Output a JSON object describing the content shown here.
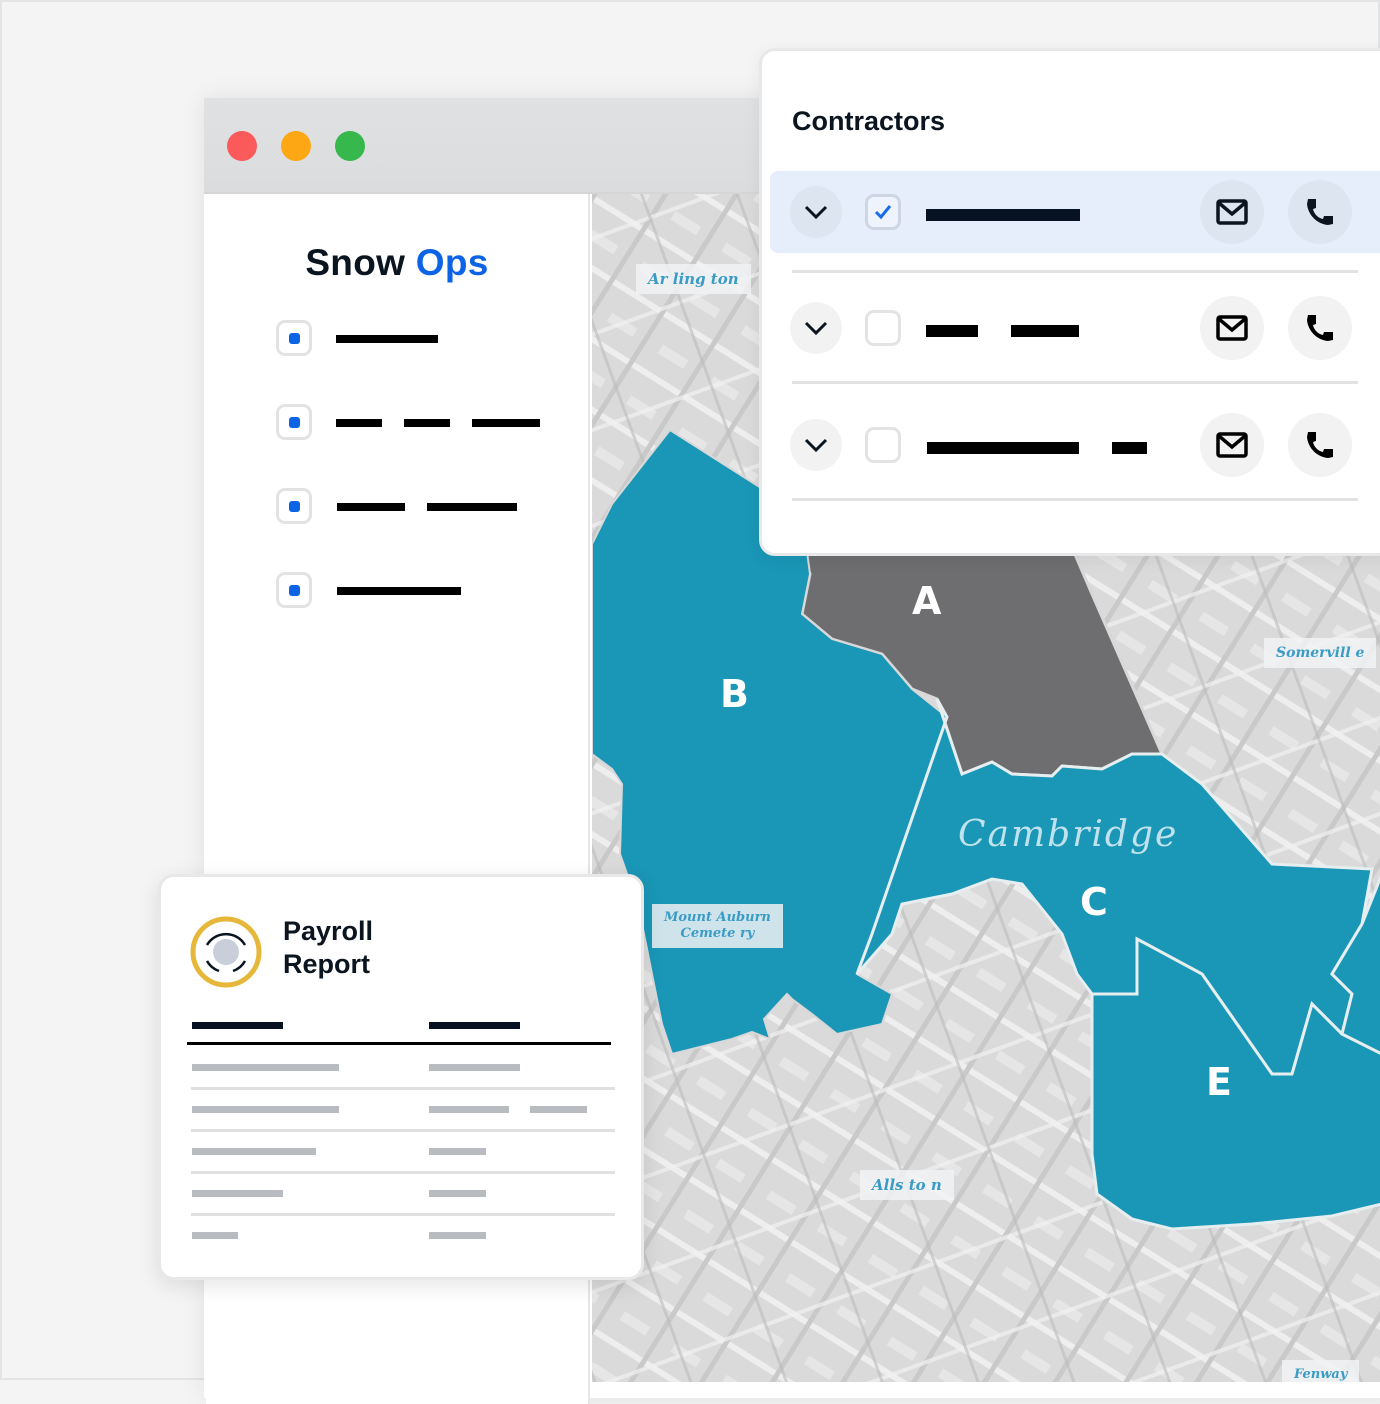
{
  "window": {
    "controls": [
      "close",
      "minimize",
      "maximize"
    ],
    "colors": {
      "close": "#fb5a5a",
      "minimize": "#fca713",
      "maximize": "#37b84c"
    }
  },
  "sidebar": {
    "brand_primary": "Snow",
    "brand_accent": "Ops",
    "accent_color": "#0c63e6",
    "items": [
      {
        "checked": true,
        "label_placeholder": "redacted"
      },
      {
        "checked": true,
        "label_placeholder": "redacted"
      },
      {
        "checked": true,
        "label_placeholder": "redacted"
      },
      {
        "checked": true,
        "label_placeholder": "redacted"
      }
    ]
  },
  "map": {
    "place_labels": {
      "arlington": "Ar ling ton",
      "somerville": "Somervill  e",
      "mount_auburn_1": "Mount  Auburn",
      "mount_auburn_2": "Cemete ry",
      "allston": "Alls to n",
      "fenway": "Fenway"
    },
    "city_label": "Cambridge",
    "zones": [
      {
        "id": "A",
        "label": "A",
        "color": "#6e6e70"
      },
      {
        "id": "B",
        "label": "B",
        "color": "#1a96b6"
      },
      {
        "id": "C",
        "label": "C",
        "color": "#1a96b6"
      },
      {
        "id": "E",
        "label": "E",
        "color": "#1a96b6"
      }
    ]
  },
  "contractors": {
    "title": "Contractors",
    "rows": [
      {
        "selected": true,
        "checked": true,
        "name_placeholder": "redacted"
      },
      {
        "selected": false,
        "checked": false,
        "name_placeholder": "redacted"
      },
      {
        "selected": false,
        "checked": false,
        "name_placeholder": "redacted"
      }
    ],
    "actions": [
      "email",
      "call"
    ]
  },
  "payroll": {
    "title_line1": "Payroll",
    "title_line2": "Report",
    "rows": 5,
    "columns": 2
  }
}
